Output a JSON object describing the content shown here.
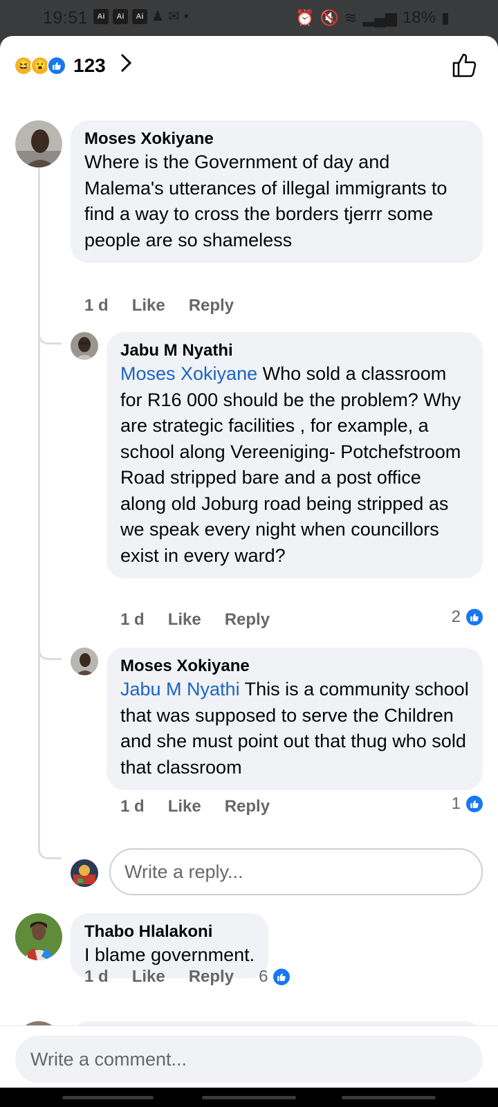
{
  "status_bar": {
    "time": "19:51",
    "badges": [
      "Ai",
      "Ai",
      "Ai"
    ],
    "battery": "18%"
  },
  "reactions": {
    "count": "123",
    "types": [
      "haha-icon",
      "wow-icon",
      "like-icon"
    ]
  },
  "comments": [
    {
      "author": "Moses Xokiyane",
      "text": "Where is the Government of day and Malema's utterances of illegal immigrants to find a way to cross the borders tjerrr  some people are so shameless",
      "age": "1 d",
      "like_label": "Like",
      "reply_label": "Reply",
      "replies": [
        {
          "author": "Jabu M Nyathi",
          "mention": "Moses Xokiyane",
          "text": " Who sold a classroom for R16 000 should be the problem? Why are strategic facilities , for example, a school along Vereeniging- Potchefstroom Road  stripped bare and a post office along old Joburg road being stripped as we speak every night when councillors exist in every ward?",
          "age": "1 d",
          "like_label": "Like",
          "reply_label": "Reply",
          "likes": "2"
        },
        {
          "author": "Moses Xokiyane",
          "mention": "Jabu M Nyathi",
          "text": " This is  a community school that was supposed to serve the Children and she must point out that thug who sold that classroom",
          "age": "1 d",
          "like_label": "Like",
          "reply_label": "Reply",
          "likes": "1"
        }
      ],
      "reply_placeholder": "Write a reply..."
    },
    {
      "author": "Thabo Hlalakoni",
      "text": "I blame government.",
      "age": "1 d",
      "like_label": "Like",
      "reply_label": "Reply",
      "likes": "6"
    }
  ],
  "comment_placeholder": "Write a comment...",
  "colors": {
    "accent": "#1877f2",
    "mention": "#1b63c4",
    "bubble": "#f0f2f5",
    "muted": "#65676b"
  }
}
